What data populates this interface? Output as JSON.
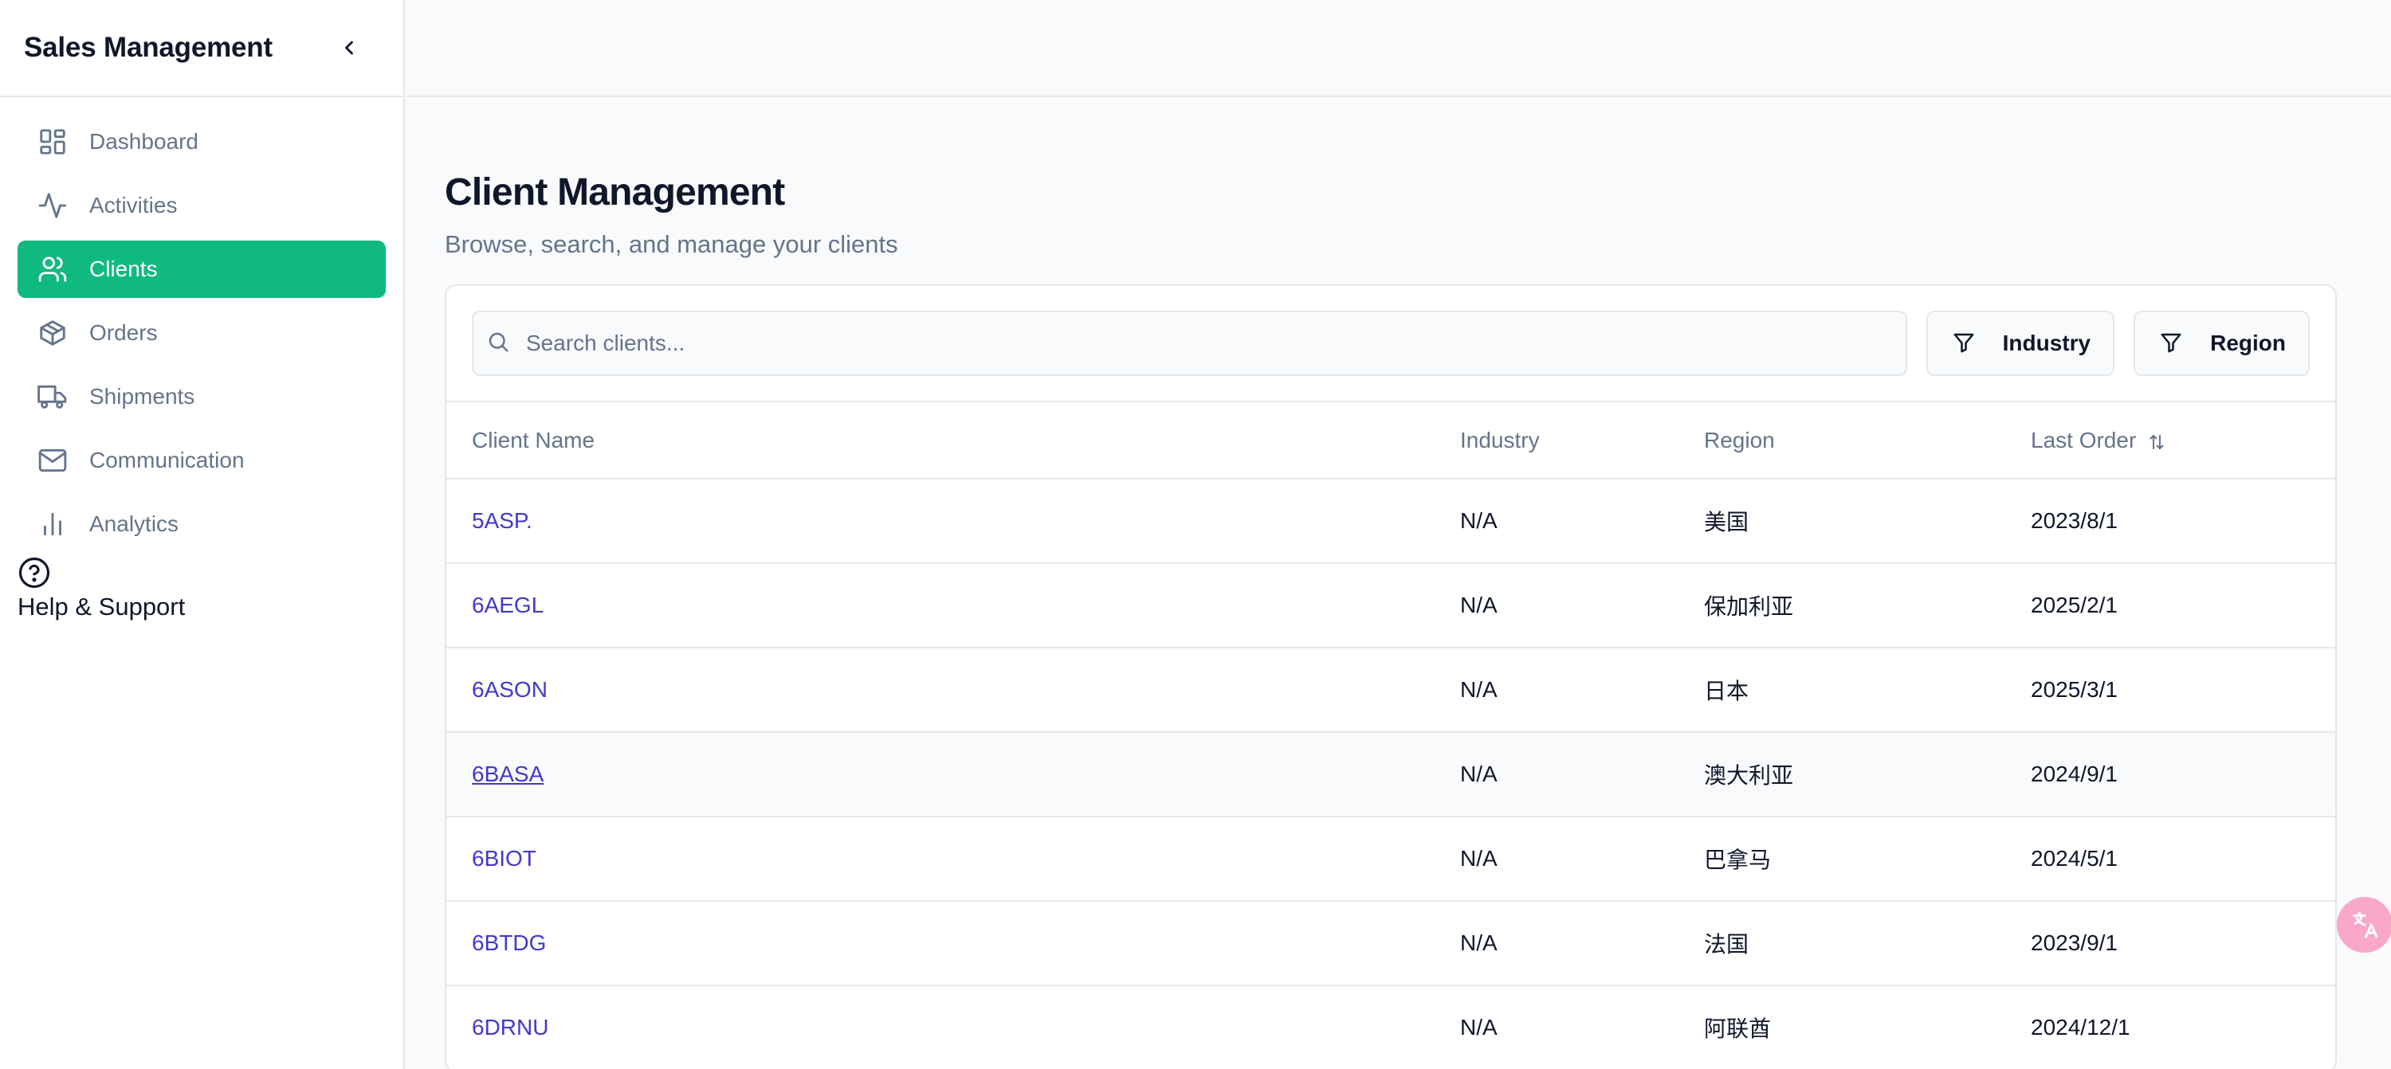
{
  "sidebar": {
    "title": "Sales Management",
    "items": [
      {
        "label": "Dashboard",
        "icon": "dashboard-icon",
        "active": false
      },
      {
        "label": "Activities",
        "icon": "activity-icon",
        "active": false
      },
      {
        "label": "Clients",
        "icon": "users-icon",
        "active": true
      },
      {
        "label": "Orders",
        "icon": "package-icon",
        "active": false
      },
      {
        "label": "Shipments",
        "icon": "truck-icon",
        "active": false
      },
      {
        "label": "Communication",
        "icon": "mail-icon",
        "active": false
      },
      {
        "label": "Analytics",
        "icon": "bar-chart-icon",
        "active": false
      }
    ],
    "help_label": "Help & Support"
  },
  "page": {
    "title": "Client Management",
    "subtitle": "Browse, search, and manage your clients"
  },
  "search": {
    "placeholder": "Search clients..."
  },
  "filters": {
    "industry_label": "Industry",
    "region_label": "Region"
  },
  "table": {
    "headers": {
      "name": "Client Name",
      "industry": "Industry",
      "region": "Region",
      "last_order": "Last Order"
    },
    "rows": [
      {
        "name": "5ASP.",
        "industry": "N/A",
        "region": "美国",
        "last_order": "2023/8/1"
      },
      {
        "name": "6AEGL",
        "industry": "N/A",
        "region": "保加利亚",
        "last_order": "2025/2/1"
      },
      {
        "name": "6ASON",
        "industry": "N/A",
        "region": "日本",
        "last_order": "2025/3/1"
      },
      {
        "name": "6BASA",
        "industry": "N/A",
        "region": "澳大利亚",
        "last_order": "2024/9/1"
      },
      {
        "name": "6BIOT",
        "industry": "N/A",
        "region": "巴拿马",
        "last_order": "2024/5/1"
      },
      {
        "name": "6BTDG",
        "industry": "N/A",
        "region": "法国",
        "last_order": "2023/9/1"
      },
      {
        "name": "6DRNU",
        "industry": "N/A",
        "region": "阿联酋",
        "last_order": "2024/12/1"
      }
    ]
  },
  "colors": {
    "accent": "#10b981",
    "link": "#4338ca",
    "muted": "#64748b"
  }
}
